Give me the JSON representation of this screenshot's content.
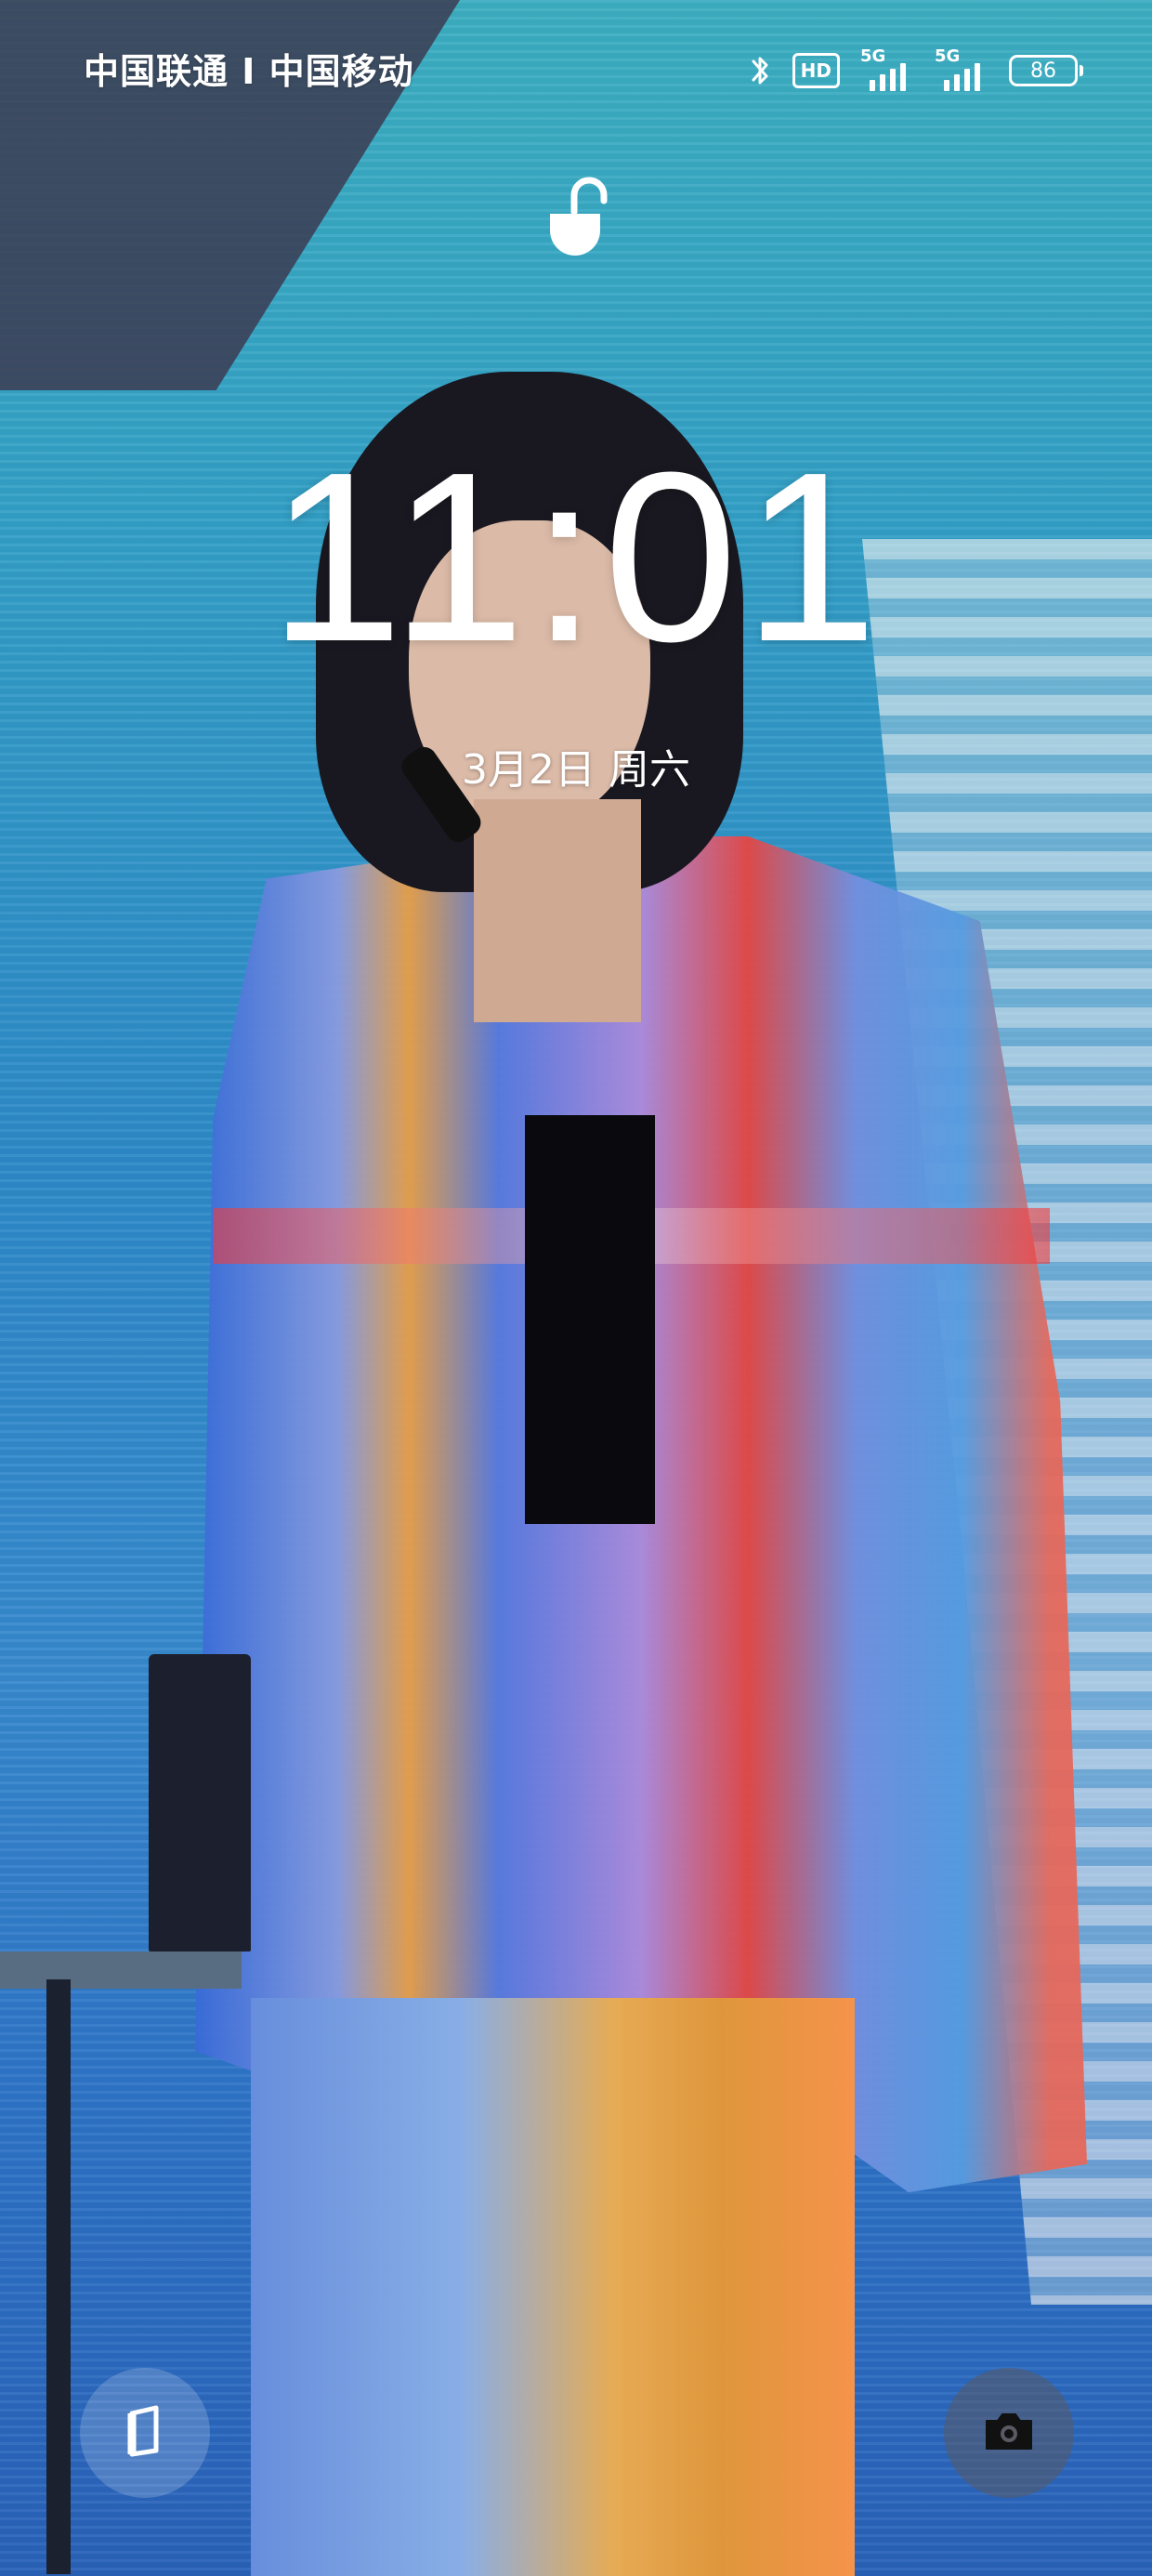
{
  "status_bar": {
    "carrier": "中国联通 I 中国移动",
    "hd_label": "HD",
    "sim1_network": "5G",
    "sim2_network": "5G",
    "battery_level": "86"
  },
  "lock_screen": {
    "time": "11:01",
    "date": "3月2日 周六"
  },
  "shortcuts": {
    "left_icon": "card-icon",
    "right_icon": "camera-icon"
  },
  "colors": {
    "text": "#ffffff",
    "shortcut_right_bg": "#5a5a64"
  }
}
